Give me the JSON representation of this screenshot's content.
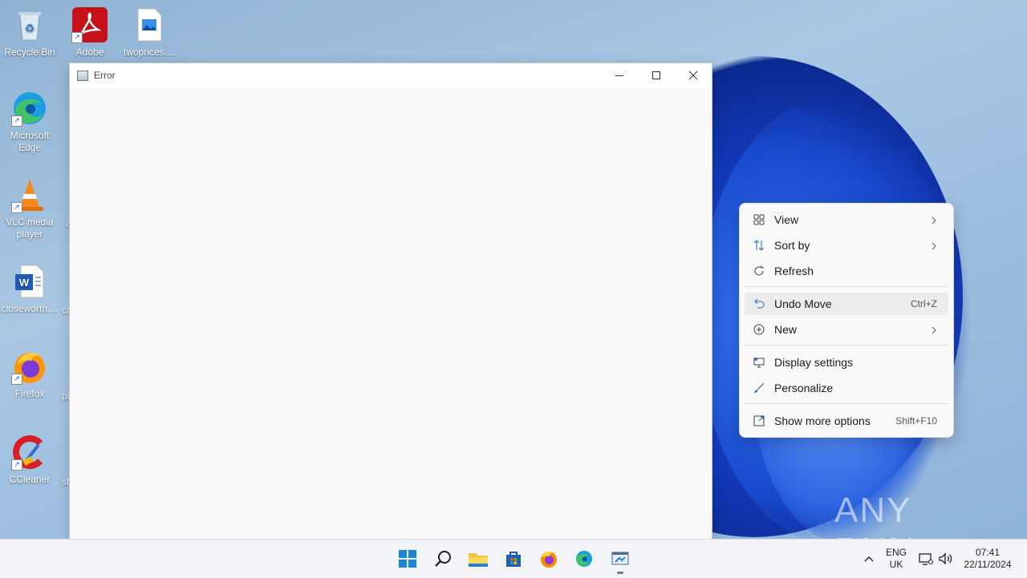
{
  "desktop": {
    "icons": [
      {
        "label": "Recycle Bin",
        "icon": "recycle-bin-icon"
      },
      {
        "label": "Adobe Acrobat",
        "icon": "adobe-acrobat-icon"
      },
      {
        "label": "twoprices....",
        "icon": "image-file-icon"
      },
      {
        "label": "Microsoft Edge",
        "icon": "edge-icon"
      },
      {
        "label": "VLC media player",
        "icon": "vlc-icon"
      },
      {
        "label": "closeworth....",
        "icon": "word-file-icon"
      },
      {
        "label": "Firefox",
        "icon": "firefox-icon"
      },
      {
        "label": "CCleaner",
        "icon": "ccleaner-icon"
      }
    ],
    "partial_labels": [
      "a",
      "ca",
      "pl",
      "st"
    ]
  },
  "window": {
    "title": "Error",
    "controls": [
      "minimize",
      "maximize",
      "close"
    ]
  },
  "context_menu": {
    "items": [
      {
        "label": "View",
        "icon": "grid-icon",
        "submenu": true
      },
      {
        "label": "Sort by",
        "icon": "sort-icon",
        "submenu": true
      },
      {
        "label": "Refresh",
        "icon": "refresh-icon"
      },
      {
        "label": "Undo Move",
        "icon": "undo-icon",
        "shortcut": "Ctrl+Z",
        "highlighted": true
      },
      {
        "label": "New",
        "icon": "plus-circle-icon",
        "submenu": true
      },
      {
        "label": "Display settings",
        "icon": "display-icon"
      },
      {
        "label": "Personalize",
        "icon": "brush-icon"
      },
      {
        "label": "Show more options",
        "icon": "more-options-icon",
        "shortcut": "Shift+F10"
      }
    ]
  },
  "taskbar": {
    "apps": [
      "start",
      "search",
      "file-explorer",
      "microsoft-store",
      "firefox",
      "edge",
      "error-app"
    ],
    "language": {
      "line1": "ENG",
      "line2": "UK"
    },
    "clock": {
      "time": "07:41",
      "date": "22/11/2024"
    }
  },
  "watermark": "ANY RUN",
  "colors": {
    "accent": "#0067c0",
    "menu_bg": "#f9f9f9",
    "taskbar_bg": "#f2f4f7"
  }
}
